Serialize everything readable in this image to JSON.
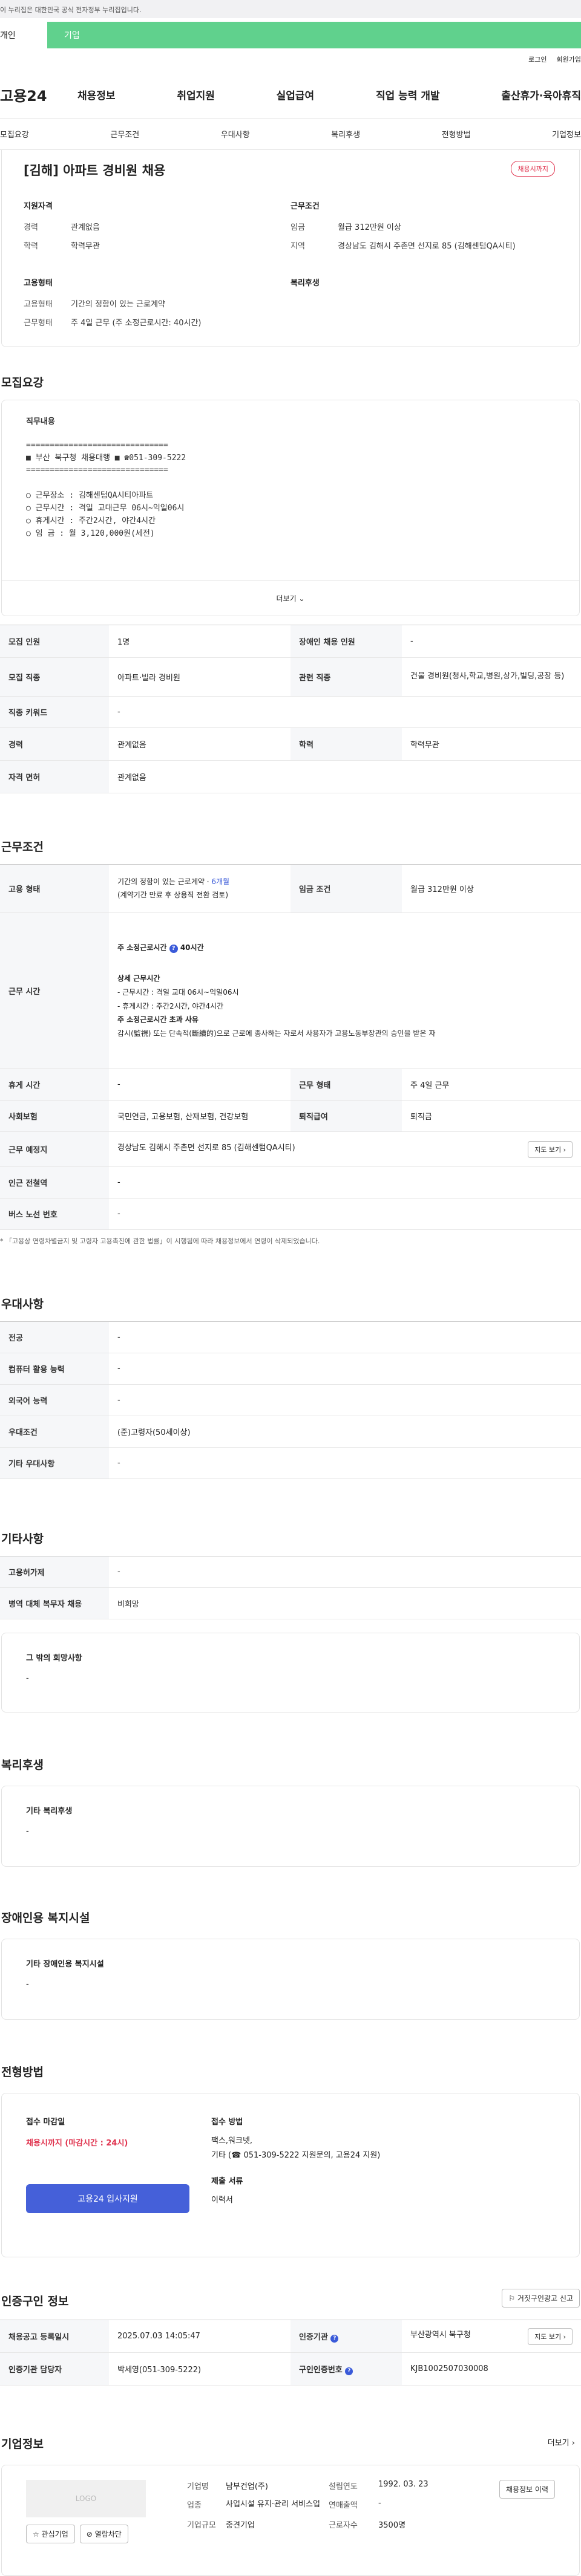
{
  "gov_notice": "이 누리집은 대한민국 공식 전자정부 누리집입니다.",
  "top_tabs": [
    "개인",
    "기업"
  ],
  "util": [
    "로그인",
    "회원가입"
  ],
  "gnb": {
    "logo": "고용24",
    "menu": [
      "채용정보",
      "취업지원",
      "실업급여",
      "직업 능력 개발",
      "출산휴가·육아휴직"
    ]
  },
  "subnav": [
    "모집요강",
    "근무조건",
    "우대사항",
    "복리후생",
    "전형방법",
    "기업정보"
  ],
  "title": {
    "heading": "[김해] 아파트 경비원 채용",
    "badge": "채용시까지",
    "qual_title": "지원자격",
    "career_k": "경력",
    "career_v": "관계없음",
    "edu_k": "학력",
    "edu_v": "학력무관",
    "cond_title": "근무조건",
    "wage_k": "임금",
    "wage_v": "월급 312만원 이상",
    "region_k": "지역",
    "region_v": "경상남도 김해시 주촌면 선지로 85 (김해센텀QA시티)",
    "emp_title": "고용형태",
    "type_k": "고용형태",
    "type_v": "기간의 정함이 있는 근로계약",
    "form_k": "근무형태",
    "form_v": "주 4일 근무 (주 소정근로시간: 40시간)",
    "welfare_title": "복리후생"
  },
  "recruit": {
    "section": "모집요강",
    "job_title": "직무내용",
    "lines": [
      "==============================",
      "■ 부산 북구청 채용대행 ■  ☎051-309-5222",
      "==============================",
      "",
      "○ 근무장소 : 김해센텀QA시티아파트",
      "○ 근무시간 : 격일 교대근무 06시~익일06시",
      "○ 휴게시간 : 주간2시간, 야간4시간",
      "○ 임     금 : 월 3,120,000원(세전)"
    ],
    "more": "더보기"
  },
  "recruit_table": [
    [
      "모집 인원",
      "1명",
      "장애인 채용 인원",
      "-"
    ],
    [
      "모집 직종",
      "아파트·빌라 경비원",
      "관련 직종",
      "건물 경비원(청사,학교,병원,상가,빌딩,공장 등)"
    ],
    [
      "직종 키워드",
      "-"
    ],
    [
      "경력",
      "관계없음",
      "학력",
      "학력무관"
    ],
    [
      "자격 면허",
      "관계없음"
    ]
  ],
  "work": {
    "section": "근무조건",
    "emp_h": "고용 형태",
    "emp_v1": "기간의 정함이 있는 근로계약 · ",
    "emp_v1b": "6개월",
    "emp_v2": "(계약기간 만료 후 상용직 전환 검토)",
    "wage_h": "임금 조건",
    "wage_v": "월급 312만원 이상",
    "time_h": "근무 시간",
    "time_main": "주 소정근로시간 ",
    "time_main_b": "40시간",
    "detail_title": "상세 근무시간",
    "detail_1": "- 근무시간 : 격일 교대 06시~익일06시",
    "detail_2": "- 휴게시간 : 주간2시간, 야간4시간",
    "over_title": "주 소정근로시간 초과 사유",
    "over_v": "감시(監視) 또는 단속적(斷續的)으로 근로에 종사하는 자로서 사용자가 고용노동부장관의 승인을 받은 자",
    "rest_h": "휴게 시간",
    "rest_v": "-",
    "form_h": "근무 형태",
    "form_v": "주 4일 근무",
    "ins_h": "사회보험",
    "ins_v": "국민연금, 고용보험, 산재보험, 건강보험",
    "sev_h": "퇴직급여",
    "sev_v": "퇴직금",
    "loc_h": "근무 예정지",
    "loc_v": "경상남도 김해시 주촌면 선지로 85 (김해센텀QA시티)",
    "map_btn": "지도 보기",
    "sub_h": "인근 전철역",
    "sub_v": "-",
    "bus_h": "버스 노선 번호",
    "bus_v": "-",
    "note": "* 「고용상 연령차별금지 및 고령자 고용촉진에 관한 법률」이 시행됨에 따라 채용정보에서 연령이 삭제되었습니다."
  },
  "pref": {
    "section": "우대사항",
    "rows": [
      [
        "전공",
        "-"
      ],
      [
        "컴퓨터 활용 능력",
        "-"
      ],
      [
        "외국어 능력",
        "-"
      ],
      [
        "우대조건",
        "(준)고령자(50세이상)"
      ],
      [
        "기타 우대사항",
        "-"
      ]
    ]
  },
  "etc": {
    "section": "기타사항",
    "rows": [
      [
        "고용허가제",
        "-"
      ],
      [
        "병역 대체 복무자 채용",
        "비희망"
      ]
    ],
    "other_title": "그 밖의 희망사항",
    "other_v": "-"
  },
  "welfare": {
    "section": "복리후생",
    "title": "기타 복리후생",
    "v": "-"
  },
  "disabled": {
    "section": "장애인용 복지시설",
    "title": "기타 장애인용 복지시설",
    "v": "-"
  },
  "apply": {
    "section": "전형방법",
    "deadline_t": "접수 마감일",
    "deadline_v": "채용시까지 (마감시간 : 24시)",
    "btn": "고용24 입사지원",
    "method_t": "접수 방법",
    "method_1": "팩스,워크넷,",
    "method_2": "기타 (☎ 051-309-5222 지원문의, 고용24 지원)",
    "doc_t": "제출 서류",
    "doc_v": "이력서"
  },
  "cert": {
    "section": "인증구인 정보",
    "report_btn": "거짓구인광고 신고",
    "date_h": "채용공고 등록일시",
    "date_v": "2025.07.03 14:05:47",
    "org_h": "인증기관",
    "org_v": "부산광역시 북구청",
    "map_btn": "지도 보기",
    "mgr_h": "인증기관 담당자",
    "mgr_v": "박세영(051-309-5222)",
    "no_h": "구인인증번호",
    "no_v": "KJB1002507030008"
  },
  "company": {
    "section": "기업정보",
    "more": "더보기",
    "logo": "LOGO",
    "fav_btn": "관심기업",
    "block_btn": "열람차단",
    "name_k": "기업명",
    "name_v": "남부건업(주)",
    "ind_k": "업종",
    "ind_v": "사업시설 유지·관리 서비스업",
    "scale_k": "기업규모",
    "scale_v": "중견기업",
    "est_k": "설립연도",
    "est_v": "1992. 03. 23",
    "sales_k": "연매출액",
    "sales_v": "-",
    "emp_k": "근로자수",
    "emp_v": "3500명",
    "detail_btn": "채용정보 이력"
  }
}
